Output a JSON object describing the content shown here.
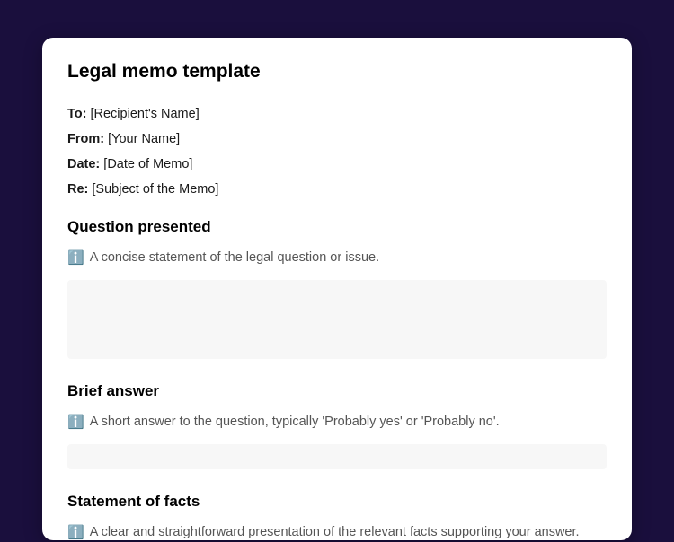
{
  "title": "Legal memo template",
  "meta": {
    "to_label": "To:",
    "to_value": " [Recipient's Name]",
    "from_label": "From:",
    "from_value": " [Your Name]",
    "date_label": "Date:",
    "date_value": " [Date of Memo]",
    "re_label": "Re:",
    "re_value": " [Subject of the Memo]"
  },
  "sections": {
    "question": {
      "heading": "Question presented",
      "icon": "ℹ️",
      "hint": "A concise statement of the legal question or issue."
    },
    "answer": {
      "heading": "Brief answer",
      "icon": "ℹ️",
      "hint": "A short answer to the question, typically 'Probably yes' or 'Probably no'."
    },
    "facts": {
      "heading": "Statement of facts",
      "icon": "ℹ️",
      "hint": "A clear and straightforward presentation of the relevant facts supporting your answer."
    }
  }
}
